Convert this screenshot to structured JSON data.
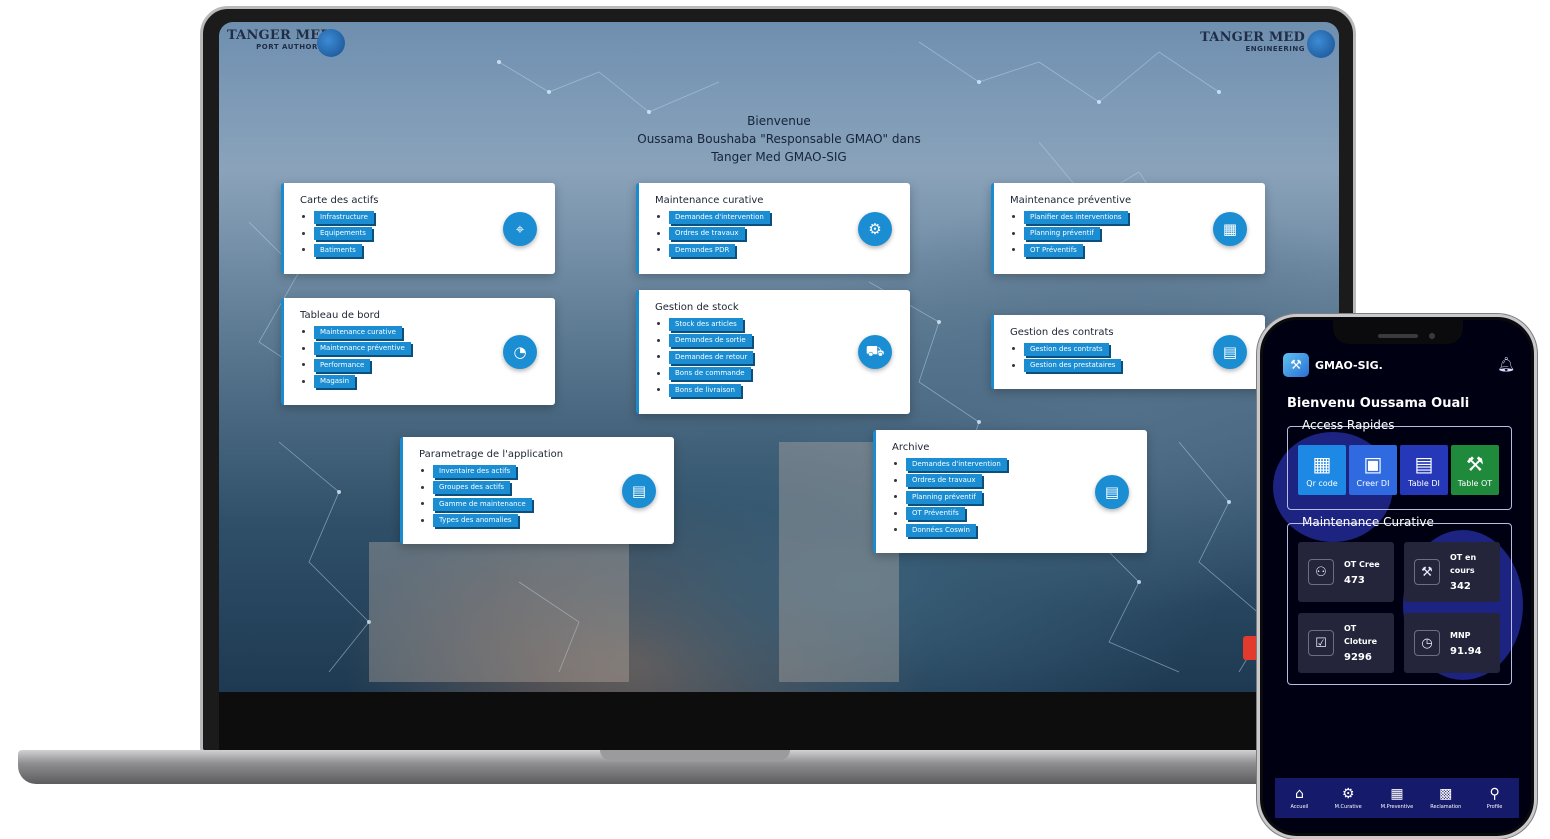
{
  "desktop": {
    "logo_left": {
      "name": "TANGER MED",
      "sub": "PORT AUTHORITY"
    },
    "logo_right": {
      "name": "TANGER MED",
      "sub": "ENGINEERING"
    },
    "welcome": {
      "line1": "Bienvenue",
      "line2": "Oussama Boushaba \"Responsable GMAO\" dans",
      "line3": "Tanger Med GMAO-SIG"
    },
    "cards": {
      "carte_actifs": {
        "title": "Carte des actifs",
        "items": [
          "Infrastructure",
          "Equipements",
          "Batiments"
        ],
        "icon": "map-pin-icon"
      },
      "maint_curative": {
        "title": "Maintenance curative",
        "items": [
          "Demandes d'intervention",
          "Ordres de travaux",
          "Demandes PDR"
        ],
        "icon": "gear-icon"
      },
      "maint_preventive": {
        "title": "Maintenance préventive",
        "items": [
          "Planifier des interventions",
          "Planning préventif",
          "OT Préventifs"
        ],
        "icon": "calendar-icon"
      },
      "tableau_bord": {
        "title": "Tableau de bord",
        "items": [
          "Maintenance curative",
          "Maintenance préventive",
          "Performance",
          "Magasin"
        ],
        "icon": "dashboard-icon"
      },
      "gestion_stock": {
        "title": "Gestion de stock",
        "items": [
          "Stock des articles",
          "Demandes de sortie",
          "Demandes de retour",
          "Bons de commande",
          "Bons de livraison"
        ],
        "icon": "cart-icon"
      },
      "gestion_contrats": {
        "title": "Gestion des contrats",
        "items": [
          "Gestion des contrats",
          "Gestion des prestataires"
        ],
        "icon": "document-icon"
      },
      "parametrage": {
        "title": "Parametrage de l'application",
        "items": [
          "Inventaire des actifs",
          "Groupes des actifs",
          "Gamme de maintenance",
          "Types des anomalies"
        ],
        "icon": "document-icon"
      },
      "archive": {
        "title": "Archive",
        "items": [
          "Demandes d'intervention",
          "Ordres de travaux",
          "Planning préventif",
          "OT Préventifs",
          "Données Coswin"
        ],
        "icon": "document-icon"
      }
    }
  },
  "mobile": {
    "app_name": "GMAO-SIG.",
    "greeting": "Bienvenu Oussama Ouali",
    "quick_access": {
      "title": "Access Rapides",
      "buttons": [
        {
          "label": "Qr code",
          "icon": "qr-code-icon",
          "color": "#1e88e5"
        },
        {
          "label": "Creer DI",
          "icon": "calendar-plus-icon",
          "color": "#2f6ae0"
        },
        {
          "label": "Table DI",
          "icon": "table-doc-icon",
          "color": "#2438b8"
        },
        {
          "label": "Table OT",
          "icon": "drill-icon",
          "color": "#1f8a3c"
        }
      ]
    },
    "curative": {
      "title": "Maintenance Curative",
      "stats": [
        {
          "label": "OT Cree",
          "value": "473",
          "icon": "user-gear-icon"
        },
        {
          "label": "OT en cours",
          "value": "342",
          "icon": "drill-icon"
        },
        {
          "label": "OT Cloture",
          "value": "9296",
          "icon": "clipboard-check-icon"
        },
        {
          "label": "MNP",
          "value": "91.94",
          "icon": "clipboard-clock-icon"
        }
      ]
    },
    "bottom_nav": [
      {
        "label": "Accueil",
        "icon": "home-icon"
      },
      {
        "label": "M.Curative",
        "icon": "gear-icon"
      },
      {
        "label": "M.Preventive",
        "icon": "calendar-icon"
      },
      {
        "label": "Reclamation",
        "icon": "qr-code-icon"
      },
      {
        "label": "Profile",
        "icon": "user-icon"
      }
    ]
  }
}
